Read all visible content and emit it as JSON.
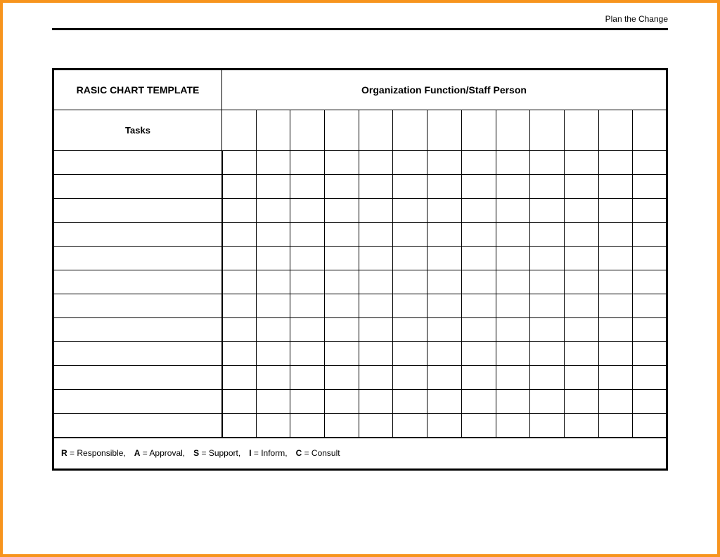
{
  "header": {
    "right_text": "Plan the Change"
  },
  "chart": {
    "title_left": "RASIC CHART TEMPLATE",
    "title_right": "Organization Function/Staff Person",
    "tasks_header": "Tasks",
    "num_staff_columns": 13,
    "num_task_rows": 12,
    "legend": [
      {
        "code": "R",
        "meaning": "Responsible"
      },
      {
        "code": "A",
        "meaning": "Approval"
      },
      {
        "code": "S",
        "meaning": "Support"
      },
      {
        "code": "I",
        "meaning": "Inform"
      },
      {
        "code": "C",
        "meaning": "Consult"
      }
    ]
  }
}
